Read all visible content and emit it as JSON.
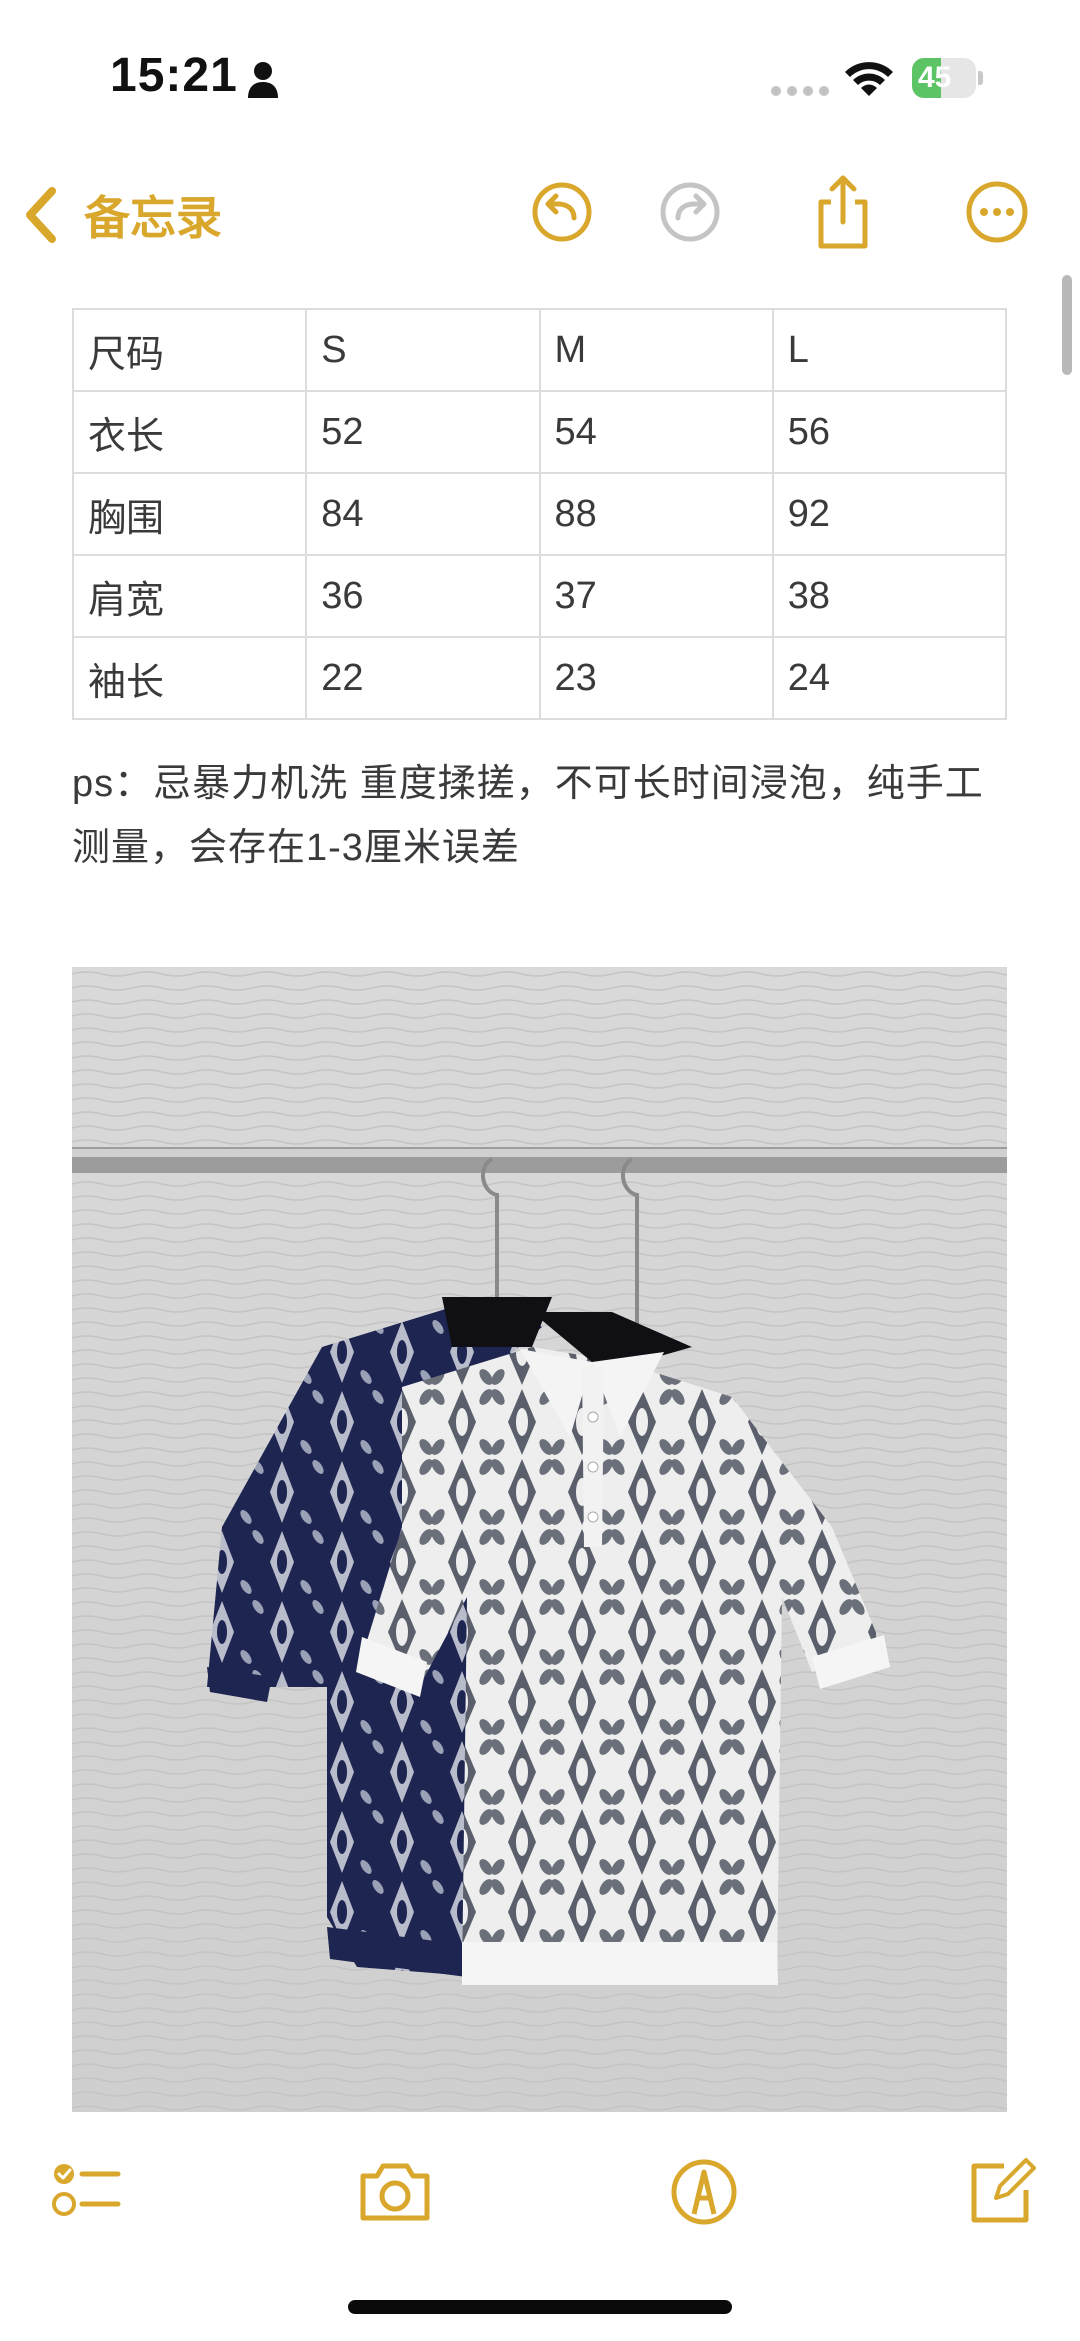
{
  "status_bar": {
    "time": "15:21",
    "battery_level": "45",
    "battery_fraction": 0.45,
    "icons": [
      "person-icon",
      "signal-dots-icon",
      "wifi-icon",
      "battery-charging-icon"
    ]
  },
  "nav": {
    "back_label": "备忘录",
    "icons": [
      "chevron-left-icon",
      "undo-icon",
      "redo-icon",
      "share-icon",
      "more-icon"
    ],
    "accent_color": "#d9a72b"
  },
  "table": {
    "rows": [
      [
        "尺码",
        "S",
        "M",
        "L"
      ],
      [
        "衣长",
        "52",
        "54",
        "56"
      ],
      [
        "胸围",
        "84",
        "88",
        "92"
      ],
      [
        "肩宽",
        "36",
        "37",
        "38"
      ],
      [
        "袖长",
        "22",
        "23",
        "24"
      ]
    ]
  },
  "note": {
    "text": "ps：忌暴力机洗 重度揉搓，不可长时间浸泡，纯手工测量，会存在1-3厘米误差"
  },
  "photo": {
    "description_icon": "product-photo",
    "subjects": [
      "navy knit polo",
      "white knit polo"
    ]
  },
  "toolbar": {
    "icons": [
      "checklist-icon",
      "camera-icon",
      "markup-icon",
      "compose-icon"
    ]
  }
}
